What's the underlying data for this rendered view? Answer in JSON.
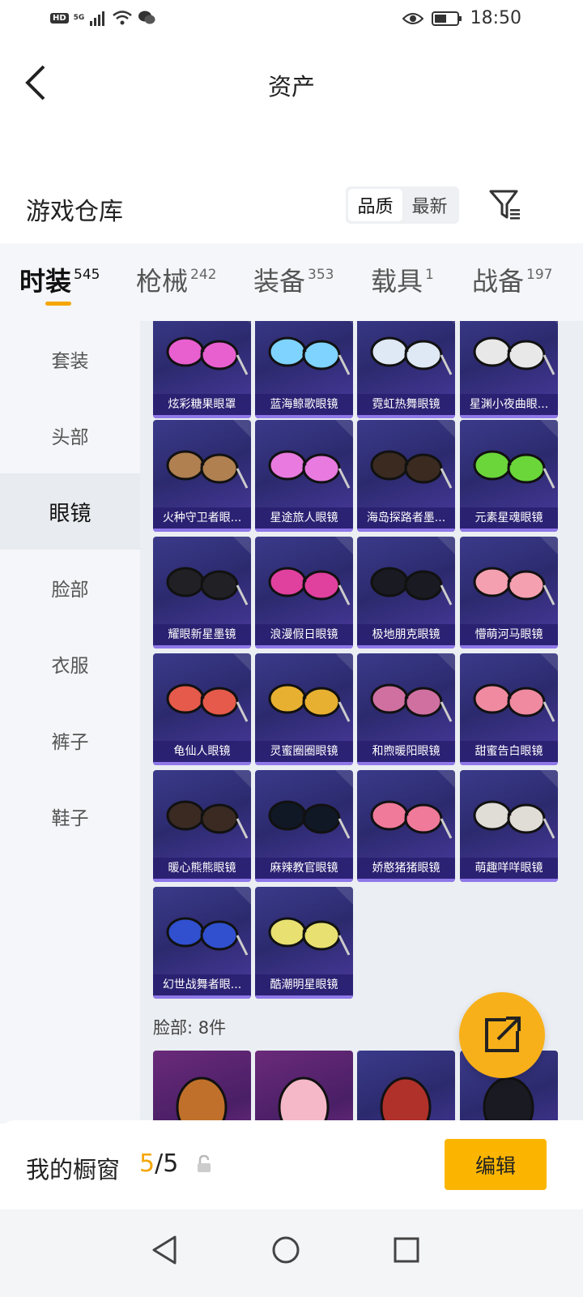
{
  "status_bar": {
    "left_badge": "HD",
    "signal_label": "5G",
    "time": "18:50"
  },
  "header": {
    "title": "资产"
  },
  "warehouse": {
    "title": "游戏仓库",
    "sort_options": [
      "品质",
      "最新"
    ],
    "sort_selected": "品质"
  },
  "tabs": [
    {
      "label": "时装",
      "count": "545",
      "active": true
    },
    {
      "label": "枪械",
      "count": "242"
    },
    {
      "label": "装备",
      "count": "353"
    },
    {
      "label": "载具",
      "count": "1"
    },
    {
      "label": "战备",
      "count": "197"
    }
  ],
  "sidebar": {
    "items": [
      "套装",
      "头部",
      "眼镜",
      "脸部",
      "衣服",
      "裤子",
      "鞋子"
    ],
    "selected": "眼镜"
  },
  "items": [
    {
      "name": "炫彩糖果眼罩",
      "icon": "candy-eye-mask-icon"
    },
    {
      "name": "蓝海鲸歌眼镜",
      "icon": "star-glasses-icon"
    },
    {
      "name": "霓虹热舞眼镜",
      "icon": "goggles-icon"
    },
    {
      "name": "星渊小夜曲眼...",
      "icon": "wire-glasses-icon"
    },
    {
      "name": "火种守卫者眼...",
      "icon": "mesh-visor-icon"
    },
    {
      "name": "星途旅人眼镜",
      "icon": "pink-visor-icon"
    },
    {
      "name": "海岛探路者墨...",
      "icon": "aviator-sunglasses-icon"
    },
    {
      "name": "元素星魂眼镜",
      "icon": "green-sunglasses-icon"
    },
    {
      "name": "耀眼新星墨镜",
      "icon": "black-sunglasses-icon"
    },
    {
      "name": "浪漫假日眼镜",
      "icon": "pink-sunglasses-icon"
    },
    {
      "name": "极地朋克眼镜",
      "icon": "dark-sunglasses-icon"
    },
    {
      "name": "懵萌河马眼镜",
      "icon": "heart-glasses-icon"
    },
    {
      "name": "龟仙人眼镜",
      "icon": "turtle-glasses-icon"
    },
    {
      "name": "灵蜜圈圈眼镜",
      "icon": "hex-glasses-icon"
    },
    {
      "name": "和煦暖阳眼镜",
      "icon": "white-sunglasses-icon"
    },
    {
      "name": "甜蜜告白眼镜",
      "icon": "pink-round-glasses-icon"
    },
    {
      "name": "暖心熊熊眼镜",
      "icon": "bear-glasses-icon"
    },
    {
      "name": "麻辣教官眼镜",
      "icon": "rect-glasses-icon"
    },
    {
      "name": "娇憨猪猪眼镜",
      "icon": "pig-glasses-icon"
    },
    {
      "name": "萌趣咩咩眼镜",
      "icon": "sheep-glasses-icon"
    },
    {
      "name": "幻世战舞者眼...",
      "icon": "gradient-sunglasses-icon"
    },
    {
      "name": "酷潮明星眼镜",
      "icon": "gold-aviator-icon"
    }
  ],
  "face_section": {
    "label": "脸部: 8件"
  },
  "face_items": [
    {
      "icon": "shield-mask-icon"
    },
    {
      "icon": "pig-mask-icon"
    },
    {
      "icon": "red-respirator-icon"
    },
    {
      "icon": "black-face-mask-icon"
    }
  ],
  "bottom": {
    "window_label": "我的橱窗",
    "window_current": "5",
    "window_sep": "/",
    "window_total": "5",
    "edit_label": "编辑"
  },
  "colors": {
    "accent": "#f5a600",
    "card_bg": "#2c2a6e",
    "button": "#fbb500"
  }
}
